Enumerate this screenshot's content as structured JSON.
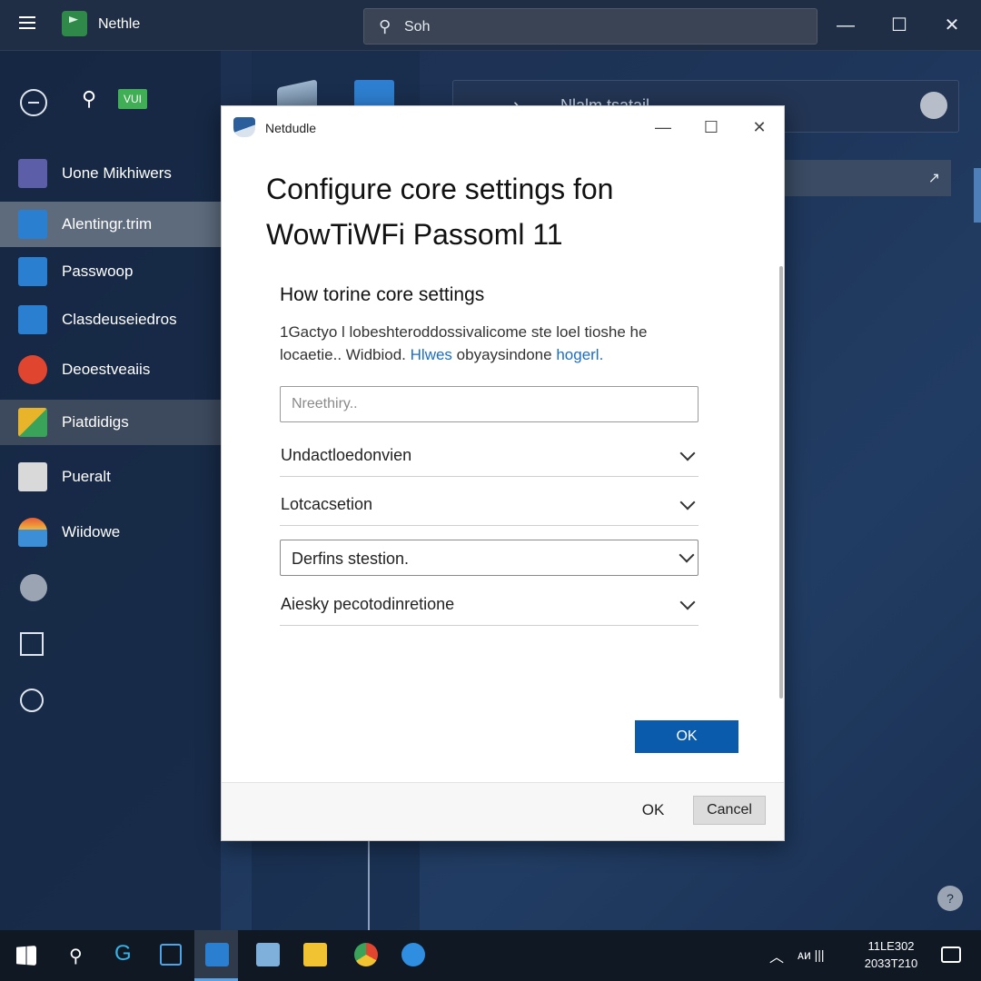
{
  "window": {
    "app_title": "Nethle",
    "search_text": "Soh",
    "controls": {
      "minimize": "—",
      "maximize": "☐",
      "close": "✕"
    }
  },
  "sidebar": {
    "badge": "VUI",
    "items": [
      {
        "label": "Uone Mikhiwers",
        "icon": "apps-grid-icon",
        "color": "#5c5fa8"
      },
      {
        "label": "Alentingr.trim",
        "icon": "display-icon",
        "color": "#2b7fd1"
      },
      {
        "label": "Passwoop",
        "icon": "settings-circle-icon",
        "color": "#2b7fd1"
      },
      {
        "label": "Clasdeuseiedros",
        "icon": "window-icon",
        "color": "#2b7fd1"
      },
      {
        "label": "Deoestveaiis",
        "icon": "chrome-icon",
        "color": "#e0452f"
      },
      {
        "label": "Piatdidigs",
        "icon": "photos-icon",
        "color": "#e8b52a"
      },
      {
        "label": "Pueralt",
        "icon": "blank-tile-icon",
        "color": "#d9d9d9"
      },
      {
        "label": "Wiidowe",
        "icon": "windows-update-icon",
        "color": "#3c8ed6"
      }
    ]
  },
  "background": {
    "nav_title": "Nlalm tsatail"
  },
  "dialog": {
    "app_title": "Netdudle",
    "heading_line1": "Configure core settings fon",
    "heading_line2": "WowTiWFi Passoml 11",
    "subheading": "How torine core settings",
    "description_line1": "1Gactyo l lobeshteroddossivalicome ste loel tioshe he",
    "description_line2": "locaetie.. Widbiod.",
    "description_link": "Hlwes",
    "description_line2_end": "obyaysindone",
    "description_link2": "hogerl.",
    "input_placeholder": "Nreethiry..",
    "rows": [
      "Undactloedonvien",
      "Lotcacsetion",
      "Derfins stestion.",
      "Aiesky pecotodinretione"
    ],
    "primary_button": "OK",
    "footer_ok": "OK",
    "footer_cancel": "Cancel"
  },
  "taskbar": {
    "tray_text": "ᴀᴎ |||",
    "clock_time": "11LE302",
    "clock_date": "2033T210"
  }
}
